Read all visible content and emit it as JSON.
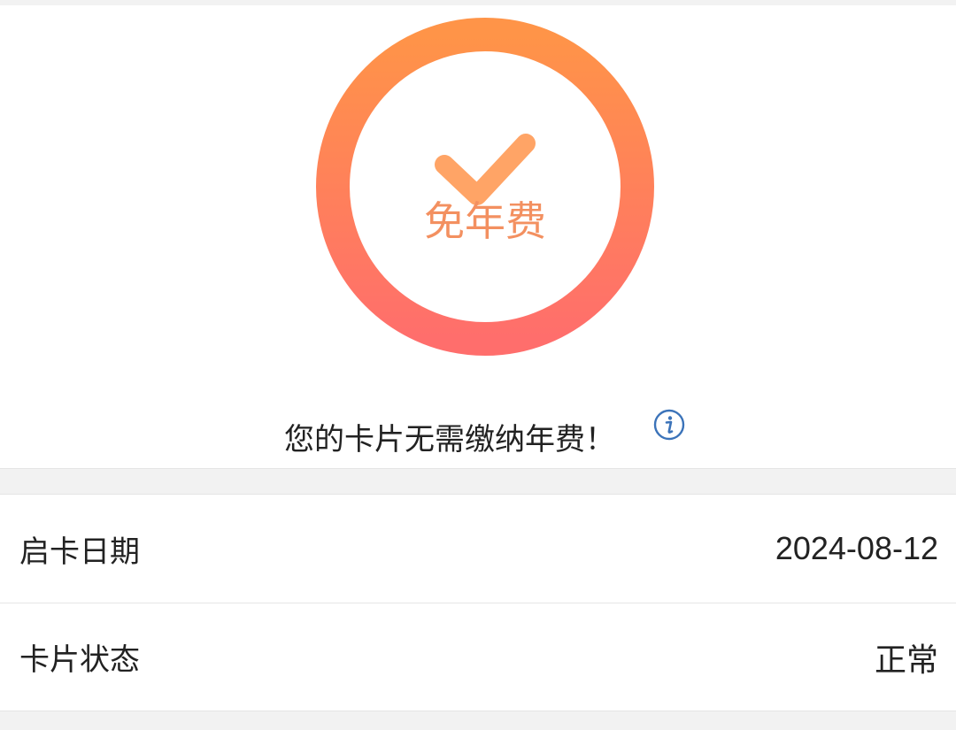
{
  "hero": {
    "badge_text": "免年费",
    "status_message": "您的卡片无需缴纳年费！",
    "icons": {
      "ring": "gradient-ring",
      "check": "check-icon",
      "info": "info-icon"
    },
    "colors": {
      "ring_top": "#FF9448",
      "ring_bottom": "#FF6E6C",
      "check": "#FF9F5E",
      "badge_text": "#F39060",
      "info_icon": "#3B73B9"
    }
  },
  "details": [
    {
      "label": "启卡日期",
      "value": "2024-08-12"
    },
    {
      "label": "卡片状态",
      "value": "正常"
    }
  ]
}
